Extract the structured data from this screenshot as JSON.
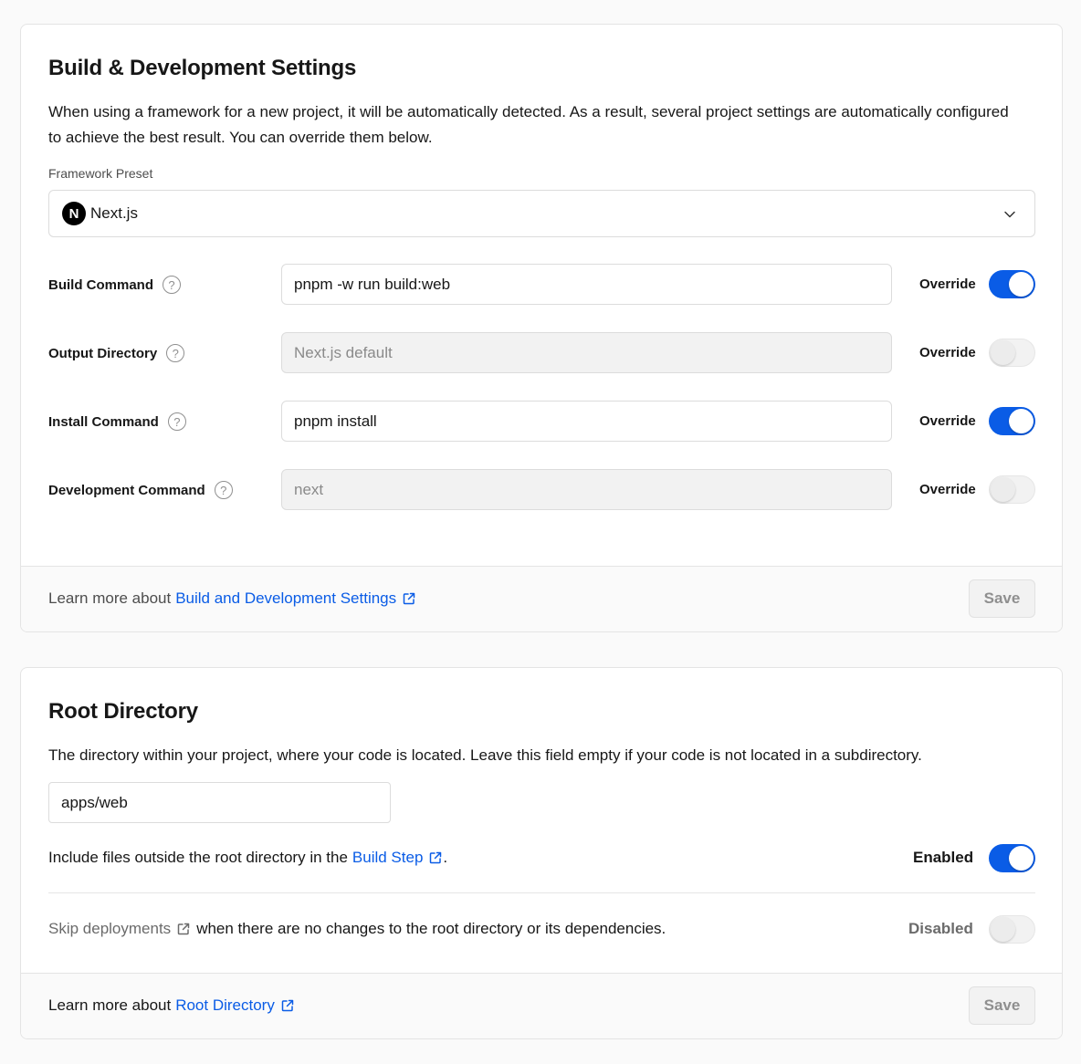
{
  "build_settings": {
    "title": "Build & Development Settings",
    "description": "When using a framework for a new project, it will be automatically detected. As a result, several project settings are automatically configured to achieve the best result. You can override them below.",
    "framework_label": "Framework Preset",
    "framework_value": "Next.js",
    "framework_logo_letter": "N",
    "override_label": "Override",
    "rows": [
      {
        "label": "Build Command",
        "value": "pnpm -w run build:web",
        "placeholder": "",
        "override": true
      },
      {
        "label": "Output Directory",
        "value": "",
        "placeholder": "Next.js default",
        "override": false
      },
      {
        "label": "Install Command",
        "value": "pnpm install",
        "placeholder": "",
        "override": true
      },
      {
        "label": "Development Command",
        "value": "",
        "placeholder": "next",
        "override": false
      }
    ],
    "footer_prefix": "Learn more about",
    "footer_link": "Build and Development Settings",
    "save_label": "Save"
  },
  "root_directory": {
    "title": "Root Directory",
    "description": "The directory within your project, where your code is located. Leave this field empty if your code is not located in a subdirectory.",
    "input_value": "apps/web",
    "include_text": "Include files outside the root directory in the",
    "include_link": "Build Step",
    "include_suffix": ".",
    "include_state": "Enabled",
    "include_enabled": true,
    "skip_link": "Skip deployments",
    "skip_text": "when there are no changes to the root directory or its dependencies.",
    "skip_state": "Disabled",
    "skip_enabled": false,
    "footer_prefix": "Learn more about",
    "footer_link": "Root Directory",
    "save_label": "Save"
  },
  "colors": {
    "accent": "#0a5ce6",
    "text": "#171717",
    "muted": "#4d4d4d",
    "background": "#fafafa"
  },
  "icons": [
    "help-circle-icon",
    "chevron-down-icon",
    "external-link-icon",
    "nextjs-logo-icon"
  ]
}
